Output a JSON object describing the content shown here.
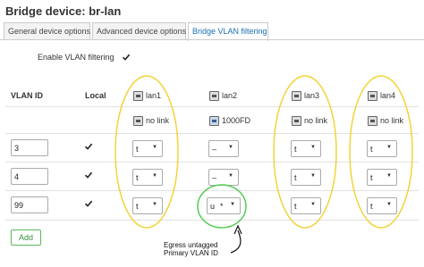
{
  "title": "Bridge device: br-lan",
  "tabs": [
    {
      "label": "General device options",
      "active": false
    },
    {
      "label": "Advanced device options",
      "active": false
    },
    {
      "label": "Bridge VLAN filtering",
      "active": true
    }
  ],
  "enable_vlan_filtering": {
    "label": "Enable VLAN filtering",
    "checked": true
  },
  "columns": {
    "vlan_id": "VLAN ID",
    "local": "Local"
  },
  "ports": [
    {
      "name": "lan1",
      "status": "no link",
      "link_up": false
    },
    {
      "name": "lan2",
      "status": "1000FD",
      "link_up": true
    },
    {
      "name": "lan3",
      "status": "no link",
      "link_up": false
    },
    {
      "name": "lan4",
      "status": "no link",
      "link_up": false
    }
  ],
  "vlans": [
    {
      "id": "3",
      "local": true,
      "ports": [
        "t",
        "–",
        "t",
        "t"
      ]
    },
    {
      "id": "4",
      "local": true,
      "ports": [
        "t",
        "–",
        "t",
        "t"
      ]
    },
    {
      "id": "99",
      "local": true,
      "ports": [
        "t",
        "u",
        "t",
        "t"
      ],
      "primary_marker": "*"
    }
  ],
  "caret": "▼",
  "add_button": "Add",
  "annotation": {
    "line1": "Egress untagged",
    "line2": "Primary VLAN ID"
  },
  "colors": {
    "accent": "#1a6fb5",
    "highlight_tagged": "#f2d33a",
    "highlight_primary": "#55cc55",
    "add_button": "#5cb85c"
  }
}
